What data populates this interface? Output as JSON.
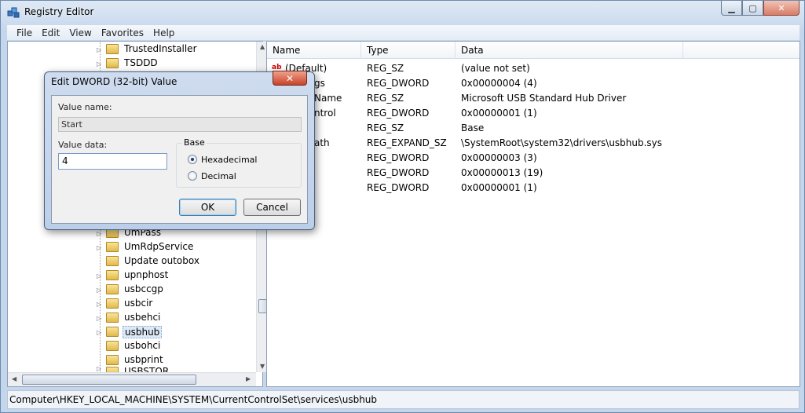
{
  "window": {
    "title": "Registry Editor"
  },
  "menu": [
    "File",
    "Edit",
    "View",
    "Favorites",
    "Help"
  ],
  "tree": {
    "items": [
      {
        "label": "TrustedInstaller",
        "expand": "▷"
      },
      {
        "label": "TSDDD",
        "expand": "▷"
      },
      {
        "label": "UmPass",
        "expand": "▷"
      },
      {
        "label": "UmRdpService",
        "expand": "▷"
      },
      {
        "label": "Update outobox",
        "expand": ""
      },
      {
        "label": "upnphost",
        "expand": "▷"
      },
      {
        "label": "usbccgp",
        "expand": "▷"
      },
      {
        "label": "usbcir",
        "expand": "▷"
      },
      {
        "label": "usbehci",
        "expand": "▷"
      },
      {
        "label": "usbhub",
        "expand": "▷"
      },
      {
        "label": "usbohci",
        "expand": ""
      },
      {
        "label": "usbprint",
        "expand": ""
      },
      {
        "label": "USBSTOR",
        "expand": "▷"
      }
    ]
  },
  "list": {
    "columns": [
      "Name",
      "Type",
      "Data"
    ],
    "rows": [
      {
        "name": "(Default)",
        "type": "REG_SZ",
        "data": "(value not set)"
      },
      {
        "name": "gs",
        "type": "REG_DWORD",
        "data": "0x00000004 (4)"
      },
      {
        "name": "Name",
        "type": "REG_SZ",
        "data": "Microsoft USB Standard Hub Driver"
      },
      {
        "name": "ntrol",
        "type": "REG_DWORD",
        "data": "0x00000001 (1)"
      },
      {
        "name": "",
        "type": "REG_SZ",
        "data": "Base"
      },
      {
        "name": "ath",
        "type": "REG_EXPAND_SZ",
        "data": "\\SystemRoot\\system32\\drivers\\usbhub.sys"
      },
      {
        "name": "",
        "type": "REG_DWORD",
        "data": "0x00000003 (3)"
      },
      {
        "name": "",
        "type": "REG_DWORD",
        "data": "0x00000013 (19)"
      },
      {
        "name": "",
        "type": "REG_DWORD",
        "data": "0x00000001 (1)"
      }
    ]
  },
  "status": "Computer\\HKEY_LOCAL_MACHINE\\SYSTEM\\CurrentControlSet\\services\\usbhub",
  "dialog": {
    "title": "Edit DWORD (32-bit) Value",
    "value_name_label": "Value name:",
    "value_name": "Start",
    "value_data_label": "Value data:",
    "value_data": "4",
    "base_label": "Base",
    "radio_hex": "Hexadecimal",
    "radio_dec": "Decimal",
    "ok": "OK",
    "cancel": "Cancel"
  }
}
